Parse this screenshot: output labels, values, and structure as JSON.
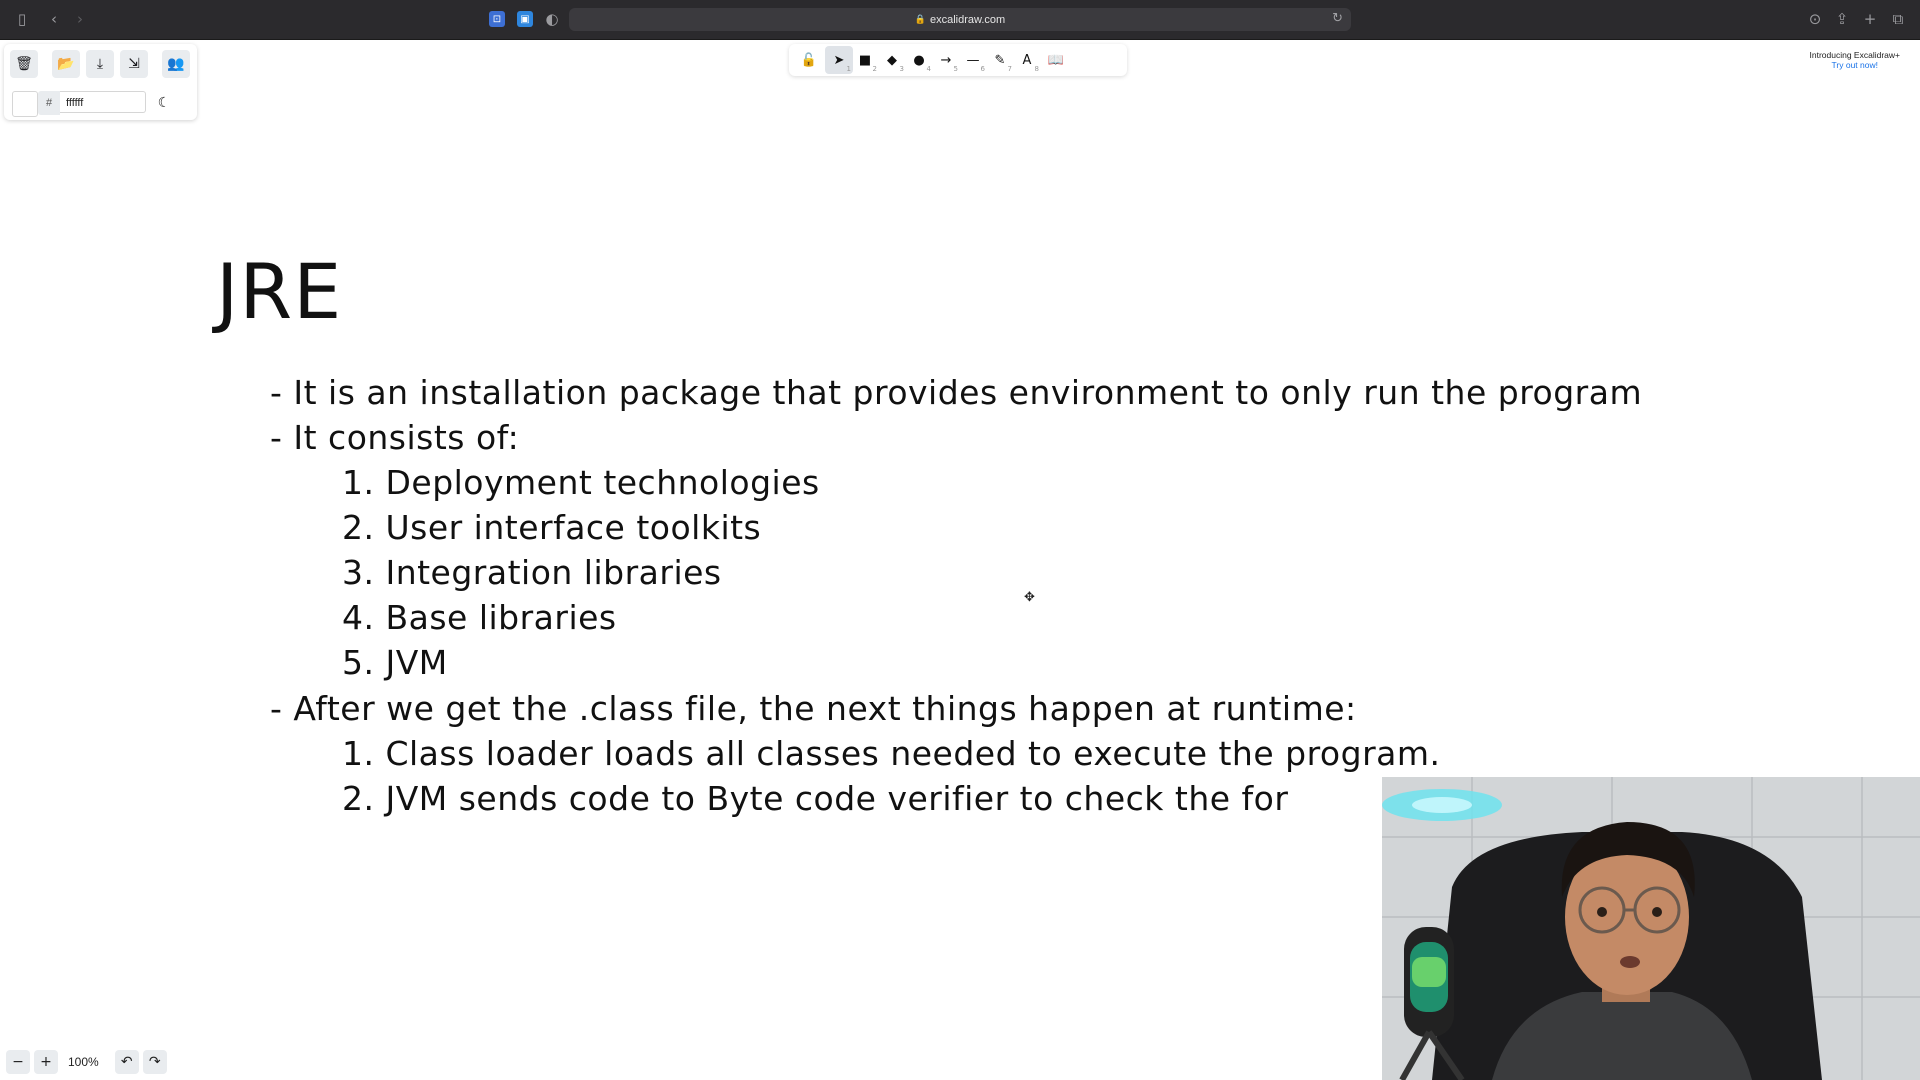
{
  "browser": {
    "url": "excalidraw.com",
    "icons": {
      "sidebar": "sidebar-icon",
      "back": "chevron-left-icon",
      "forward": "chevron-right-icon",
      "reload": "reload-icon",
      "download": "download-icon",
      "share": "share-icon",
      "newtab": "plus-icon",
      "tabs": "tabs-overview-icon"
    }
  },
  "left_panel": {
    "color_hash": "#",
    "color_value": "ffffff"
  },
  "toolbar": {
    "tools": [
      {
        "name": "lock",
        "glyph": "🔓",
        "key": ""
      },
      {
        "name": "selection",
        "glyph": "➤",
        "key": "1"
      },
      {
        "name": "rectangle",
        "glyph": "■",
        "key": "2"
      },
      {
        "name": "diamond",
        "glyph": "◆",
        "key": "3"
      },
      {
        "name": "ellipse",
        "glyph": "●",
        "key": "4"
      },
      {
        "name": "arrow",
        "glyph": "→",
        "key": "5"
      },
      {
        "name": "line",
        "glyph": "—",
        "key": "6"
      },
      {
        "name": "draw",
        "glyph": "✎",
        "key": "7"
      },
      {
        "name": "text",
        "glyph": "A",
        "key": "8"
      },
      {
        "name": "library",
        "glyph": "📖",
        "key": ""
      }
    ],
    "active": "selection"
  },
  "promo": {
    "line1": "Introducing Excalidraw+",
    "line2": "Try out now!"
  },
  "canvas": {
    "title": "JRE",
    "lines": [
      "- It is an installation package that provides environment to only run the program",
      "- It consists of:",
      "1. Deployment technologies",
      "2. User interface toolkits",
      "3. Integration libraries",
      "4. Base libraries",
      "5. JVM",
      "- After we get the .class file, the next things happen at runtime:",
      "1. Class loader loads all classes needed to execute the program.",
      "2. JVM sends code to Byte code verifier to check the for"
    ]
  },
  "zoom": {
    "minus": "−",
    "plus": "+",
    "value": "100%",
    "undo": "↶",
    "redo": "↷"
  }
}
